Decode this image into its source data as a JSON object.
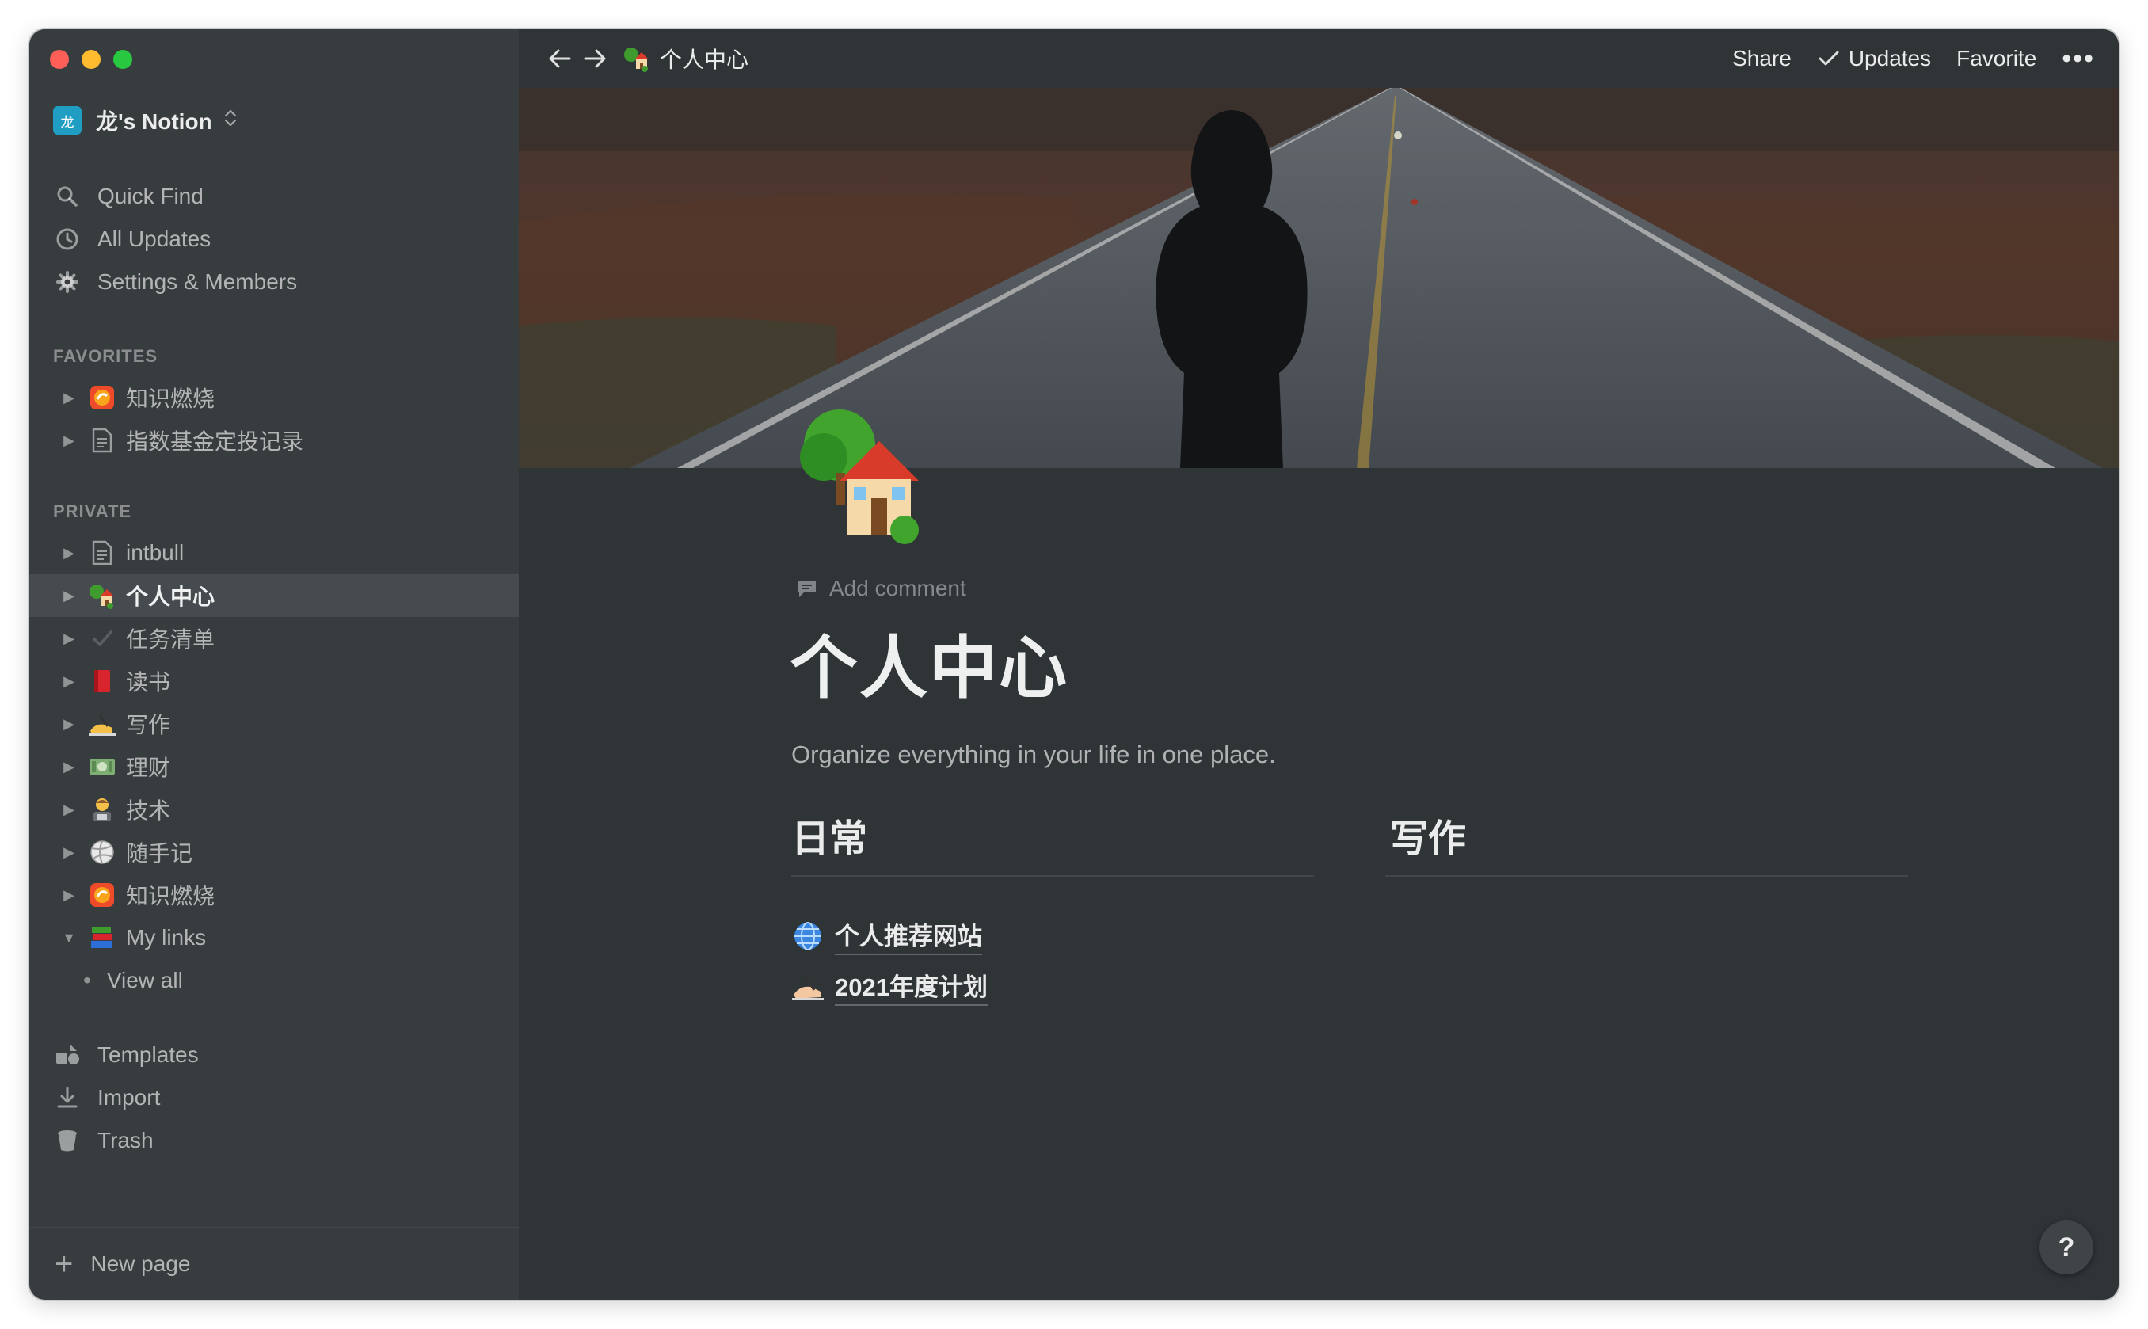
{
  "workspace": {
    "badge": "龙",
    "name": "龙's Notion"
  },
  "utilities": [
    {
      "label": "Quick Find",
      "icon": "search-icon"
    },
    {
      "label": "All Updates",
      "icon": "clock-icon"
    },
    {
      "label": "Settings & Members",
      "icon": "gear-icon"
    }
  ],
  "favorites": {
    "heading": "FAVORITES",
    "items": [
      {
        "label": "知识燃烧",
        "icon": "orange-badge-icon"
      },
      {
        "label": "指数基金定投记录",
        "icon": "document-icon"
      }
    ]
  },
  "private": {
    "heading": "PRIVATE",
    "items": [
      {
        "label": "intbull",
        "icon": "document-icon"
      },
      {
        "label": "个人中心",
        "icon": "house-tree-icon",
        "selected": true
      },
      {
        "label": "任务清单",
        "icon": "check-icon"
      },
      {
        "label": "读书",
        "icon": "red-book-icon"
      },
      {
        "label": "写作",
        "icon": "writing-hand-icon"
      },
      {
        "label": "理财",
        "icon": "money-icon"
      },
      {
        "label": "技术",
        "icon": "technologist-icon"
      },
      {
        "label": "随手记",
        "icon": "volleyball-icon"
      },
      {
        "label": "知识燃烧",
        "icon": "orange-badge-icon"
      },
      {
        "label": "My links",
        "icon": "books-icon",
        "expanded": true
      }
    ],
    "child": {
      "label": "View all"
    }
  },
  "tools": [
    {
      "label": "Templates",
      "icon": "templates-icon"
    },
    {
      "label": "Import",
      "icon": "import-icon"
    },
    {
      "label": "Trash",
      "icon": "trash-icon"
    }
  ],
  "new_page": "New page",
  "topbar": {
    "breadcrumb": "个人中心",
    "share": "Share",
    "updates": "Updates",
    "favorite": "Favorite",
    "more": "•••"
  },
  "page": {
    "add_comment": "Add comment",
    "title": "个人中心",
    "description": "Organize everything in your life in one place.",
    "columns": [
      {
        "heading": "日常",
        "links": [
          {
            "label": "个人推荐网站",
            "icon": "globe-icon"
          },
          {
            "label": "2021年度计划",
            "icon": "writing-hand-icon"
          }
        ]
      },
      {
        "heading": "写作",
        "links": []
      }
    ]
  },
  "help": "?",
  "colors": {
    "sidebar_bg": "#373c3f",
    "main_bg": "#2f3437",
    "selected_bg": "#454b4e"
  }
}
